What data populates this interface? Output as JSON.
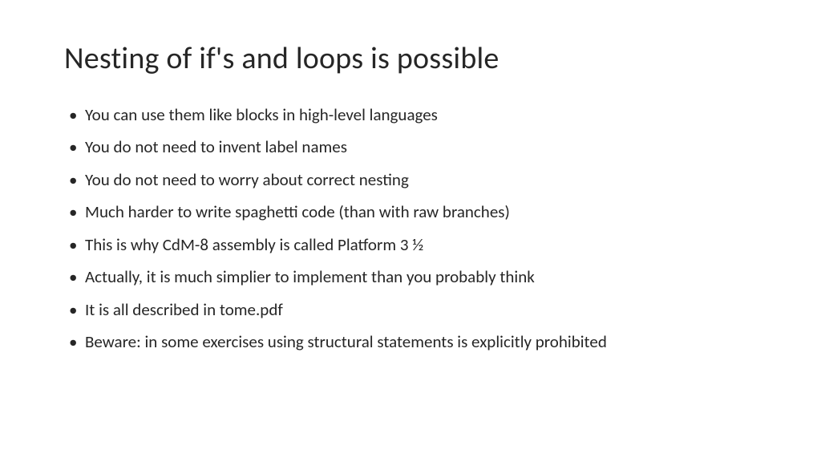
{
  "slide": {
    "title": "Nesting of if's and loops is possible",
    "bullets": [
      "You can use them like blocks in high-level languages",
      "You do not need to invent label names",
      "You do not need to worry about correct nesting",
      "Much harder to write spaghetti code (than with raw branches)",
      "This is why CdM-8 assembly is called Platform 3 ½",
      "Actually, it is much simplier to implement than you probably think",
      "It is all described in tome.pdf",
      "Beware: in some exercises using structural statements is explicitly prohibited"
    ]
  }
}
